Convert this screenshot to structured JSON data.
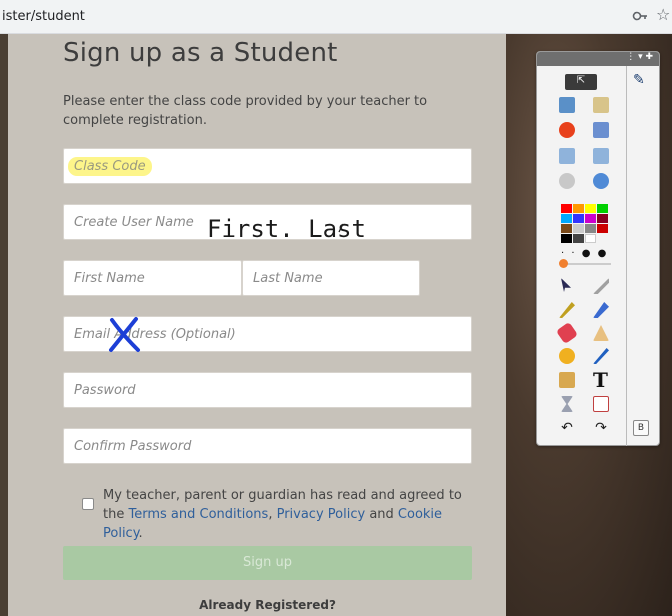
{
  "browser": {
    "url_fragment": "ister/student",
    "key_icon": "key-icon",
    "star_icon": "star-icon"
  },
  "form": {
    "title": "Sign up as a Student",
    "intro": "Please enter the class code provided by your teacher to complete registration.",
    "fields": {
      "class_code": "Class Code",
      "user_name": "Create User Name",
      "first_name": "First Name",
      "last_name": "Last Name",
      "email": "Email Address (Optional)",
      "password": "Password",
      "confirm_password": "Confirm Password"
    },
    "annotation_text": "First. Last",
    "terms_prefix": "My teacher, parent or guardian has read and agreed to the",
    "terms_link": "Terms and Conditions",
    "terms_sep1": ", ",
    "privacy_link": "Privacy Policy",
    "terms_and": " and ",
    "cookie_link": "Cookie Policy",
    "terms_end": ".",
    "signup_label": "Sign up",
    "already_label": "Already Registered?"
  },
  "toolbar": {
    "menu_glyphs": "⋮ ▾ ✚",
    "share_glyph": "⇱",
    "b_label": "B"
  },
  "colors": {
    "accent": "#2f5f9b",
    "signup": "#a9c9a3",
    "highlight": "#fdf58a"
  }
}
